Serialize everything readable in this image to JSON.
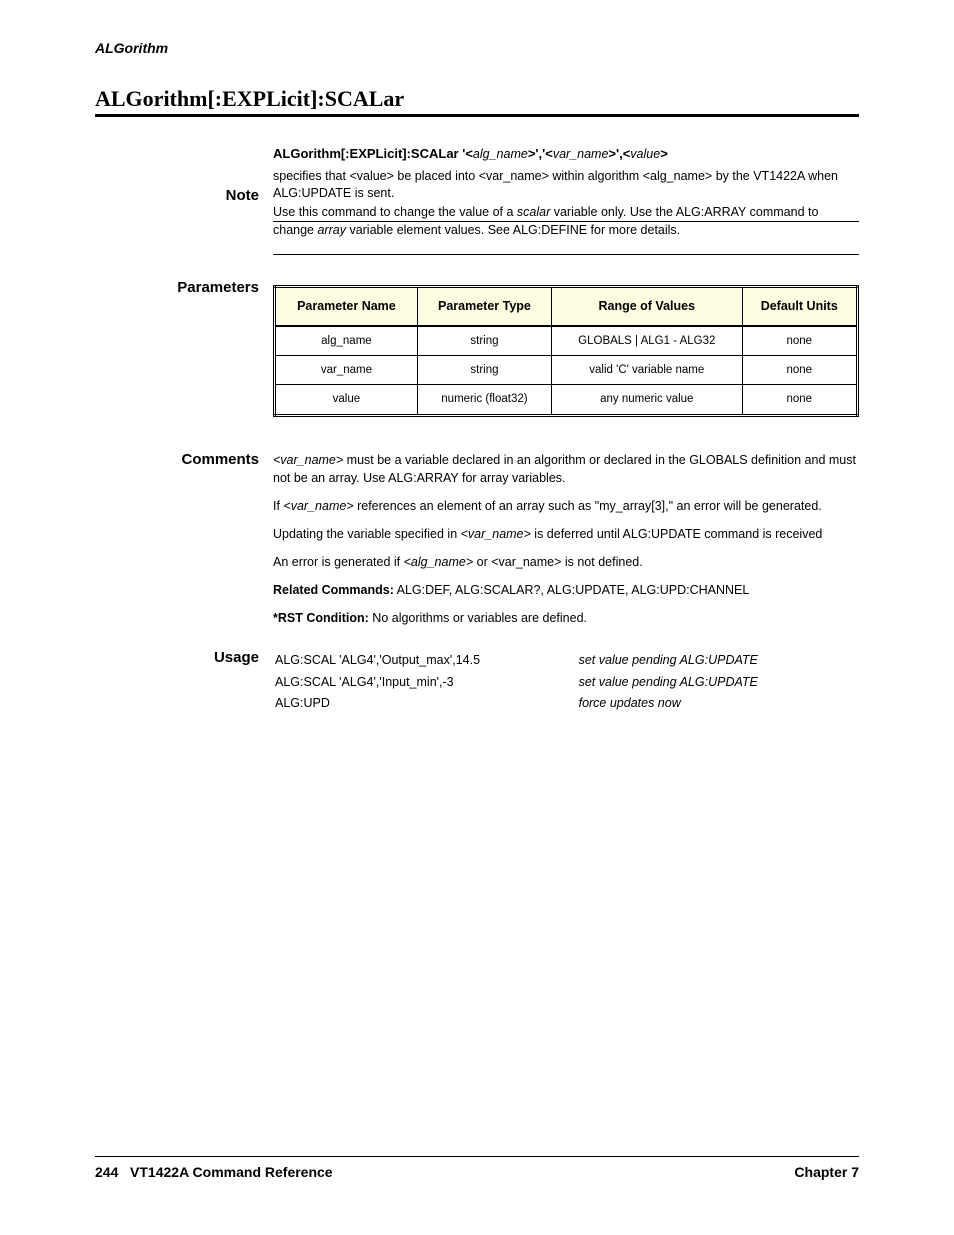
{
  "header_section": "ALGorithm",
  "title": "ALGorithm[:EXPLicit]:SCALar",
  "syntax": {
    "cmd": "ALGorithm[:EXPLicit]:SCALar '<",
    "p1": "alg_name",
    "sep1": ">','<",
    "p2": "var_name",
    "sep2": ">',<",
    "p3": "value",
    "sep3": ">",
    "desc1": "specifies that ",
    "desc_val": "<value>",
    "desc2": " be placed into ",
    "desc_var": "<var_name>",
    "desc3": " within algorithm ",
    "desc_alg": "<alg_name>",
    "desc4": " by the VT1422A when ALG:UPDATE is sent."
  },
  "note_label": "Note",
  "note_text_1": "Use this command to change the value of a ",
  "note_em1": "scalar",
  "note_text_2": " variable only. Use the ALG:ARRAY command to change ",
  "note_em2": "array",
  "note_text_3": " variable element values. See ALG:DEFINE for more details.",
  "parameters_label": "Parameters",
  "table": {
    "headers": [
      "Parameter Name",
      "Parameter Type",
      "Range of Values",
      "Default Units"
    ],
    "rows": [
      [
        "alg_name",
        "string",
        "GLOBALS | ALG1 - ALG32",
        "none"
      ],
      [
        "var_name",
        "string",
        "valid 'C' variable name",
        "none"
      ],
      [
        "value",
        "numeric (float32)",
        "any numeric value",
        "none"
      ]
    ]
  },
  "comments_label": "Comments",
  "comments": [
    {
      "lead": "<var_name>",
      "lead_style": "i",
      "rest": " must be a variable declared in an algorithm or declared in the GLOBALS definition and must not be an array. Use ALG:ARRAY for array variables."
    },
    {
      "lead": "If ",
      "lead_style": "",
      "rest_pre": "<var_name>",
      "rest_pre_style": "i",
      "rest": " references an element of an array such as \"my_array[3],\" an error will be generated."
    },
    {
      "lead": "Updating the variable specified in ",
      "lead_style": "",
      "rest_pre": "<var_name>",
      "rest_pre_style": "i",
      "rest": " is deferred until ALG:UPDATE command is received"
    },
    {
      "lead": "An error is generated if ",
      "lead_style": "",
      "rest_pre": "<alg_name>",
      "rest_pre_style": "i",
      "rest": " or <var_name> is not defined."
    },
    {
      "lead": "Related Commands:",
      "lead_style": "b",
      "rest": " ALG:DEF, ALG:SCALAR?, ALG:UPDATE, ALG:UPD:CHANNEL"
    },
    {
      "lead": "*RST Condition:",
      "lead_style": "b",
      "rest": " No algorithms or variables are defined."
    }
  ],
  "usage_label": "Usage",
  "usage_rows": [
    {
      "code": "ALG:SCAL 'ALG4','Output_max',14.5",
      "comment": "set value pending ALG:UPDATE"
    },
    {
      "code": "ALG:SCAL 'ALG4','Input_min',-3",
      "comment": "set value pending ALG:UPDATE"
    },
    {
      "code": "ALG:UPD",
      "comment": "force updates now"
    }
  ],
  "footer": {
    "page": "244",
    "left": "VT1422A Command Reference",
    "right": "Chapter 7"
  }
}
